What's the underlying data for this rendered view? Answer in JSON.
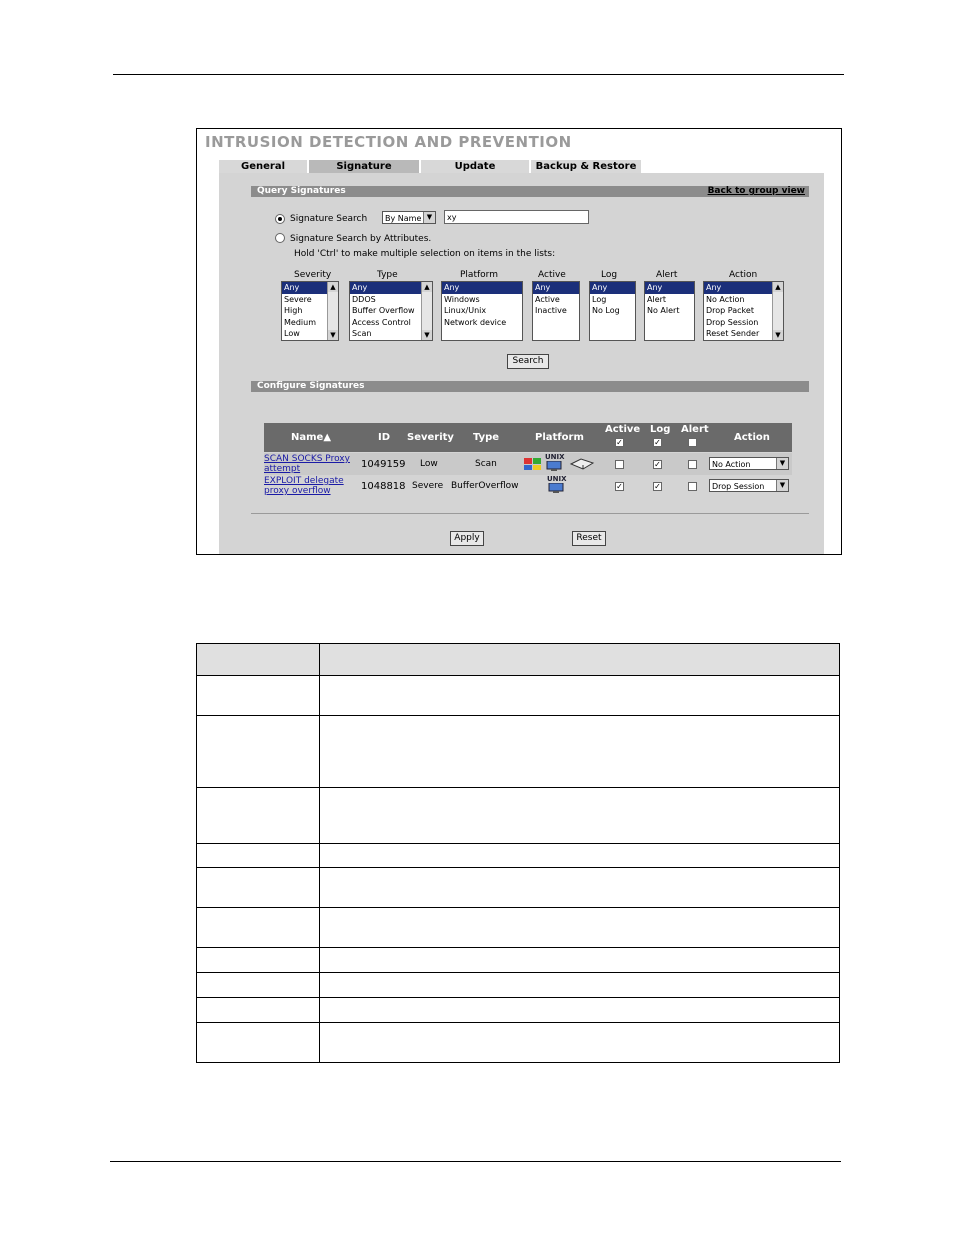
{
  "screen": {
    "title": "INTRUSION DETECTION AND PREVENTION",
    "tabs": [
      "General",
      "Signature",
      "Update",
      "Backup & Restore"
    ],
    "query_section": {
      "title": "Query Signatures",
      "back_link": "Back to group view",
      "radio_search_label": "Signature Search",
      "search_by_value": "By Name",
      "search_text_value": "xy",
      "radio_attr_label": "Signature Search by Attributes.",
      "hint": "Hold 'Ctrl' to make multiple selection on items in the lists:",
      "lists": {
        "severity": {
          "label": "Severity",
          "options": [
            "Any",
            "Severe",
            "High",
            "Medium",
            "Low"
          ]
        },
        "type": {
          "label": "Type",
          "options": [
            "Any",
            "DDOS",
            "Buffer Overflow",
            "Access Control",
            "Scan"
          ]
        },
        "platform": {
          "label": "Platform",
          "options": [
            "Any",
            "Windows",
            "Linux/Unix",
            "Network device"
          ]
        },
        "active": {
          "label": "Active",
          "options": [
            "Any",
            "Active",
            "Inactive"
          ]
        },
        "log": {
          "label": "Log",
          "options": [
            "Any",
            "Log",
            "No Log"
          ]
        },
        "alert": {
          "label": "Alert",
          "options": [
            "Any",
            "Alert",
            "No Alert"
          ]
        },
        "action": {
          "label": "Action",
          "options": [
            "Any",
            "No Action",
            "Drop Packet",
            "Drop Session",
            "Reset Sender"
          ]
        }
      },
      "search_button": "Search"
    },
    "configure_section": {
      "title": "Configure Signatures",
      "columns": {
        "name": "Name",
        "id": "ID",
        "severity": "Severity",
        "type": "Type",
        "platform": "Platform",
        "active": "Active",
        "log": "Log",
        "alert": "Alert",
        "action": "Action"
      },
      "rows": [
        {
          "name_line1": "SCAN SOCKS Proxy",
          "name_line2": "attempt",
          "id": "1049159",
          "severity": "Low",
          "type": "Scan",
          "platform_label": "UNIX",
          "active": false,
          "log": true,
          "alert": false,
          "action": "No Action"
        },
        {
          "name_line1": "EXPLOIT delegate",
          "name_line2": "proxy overflow",
          "id": "1048818",
          "severity": "Severe",
          "type": "BufferOverflow",
          "platform_label": "UNIX",
          "active": true,
          "log": true,
          "alert": false,
          "action": "Drop Session"
        }
      ],
      "apply_button": "Apply",
      "reset_button": "Reset"
    }
  },
  "colors": {
    "panel_bg": "#d4d4d4",
    "section_bar": "#8c8c8c",
    "table_header": "#6a6a6a",
    "selected_option": "#1b2f7a",
    "link": "#1a1aa6"
  }
}
